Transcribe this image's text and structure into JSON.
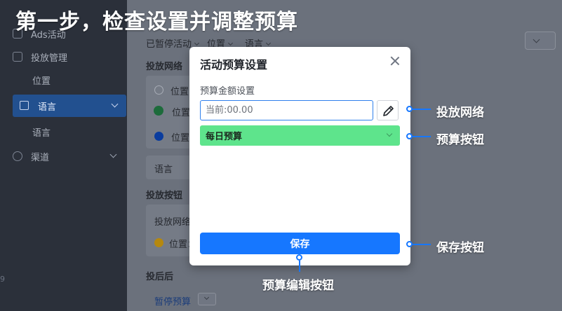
{
  "heading": "第一步，检查设置并调整预算",
  "sidebar": {
    "items": [
      {
        "label": "Ads活动"
      },
      {
        "label": "投放管理"
      },
      {
        "label": "位置"
      },
      {
        "label": "语言"
      },
      {
        "label": "语言"
      },
      {
        "label": "渠道"
      }
    ],
    "left_number": "9"
  },
  "main": {
    "filters": [
      "已暂停活动",
      "位置",
      "语言"
    ],
    "section_network": "投放网络",
    "option_1": "位置",
    "option_2": "位置",
    "option_3": "位置",
    "section_language": "语言",
    "section_buttons": "投放按钮",
    "sub_network": "投放网络",
    "option_4": "位置：",
    "section_after": "投后后",
    "pause_label": "暂停预算"
  },
  "modal": {
    "title": "活动预算设置",
    "field_label": "预算金额设置",
    "amount_placeholder": "当前:00.00",
    "budget_type": "每日预算",
    "save_label": "保存"
  },
  "annotations": {
    "network": "投放网络",
    "budget_button": "预算按钮",
    "save_button": "保存按钮",
    "edit_button": "预算编辑按钮"
  },
  "colors": {
    "primary": "#1677ff",
    "budget_green": "#5ee48c",
    "status_green": "#1d6b3b",
    "status_blue": "#0a3c9e",
    "status_orange": "#b5880f"
  },
  "icons": [
    "close-icon",
    "pencil-icon",
    "chevron-down-icon",
    "check-circle-icon"
  ]
}
